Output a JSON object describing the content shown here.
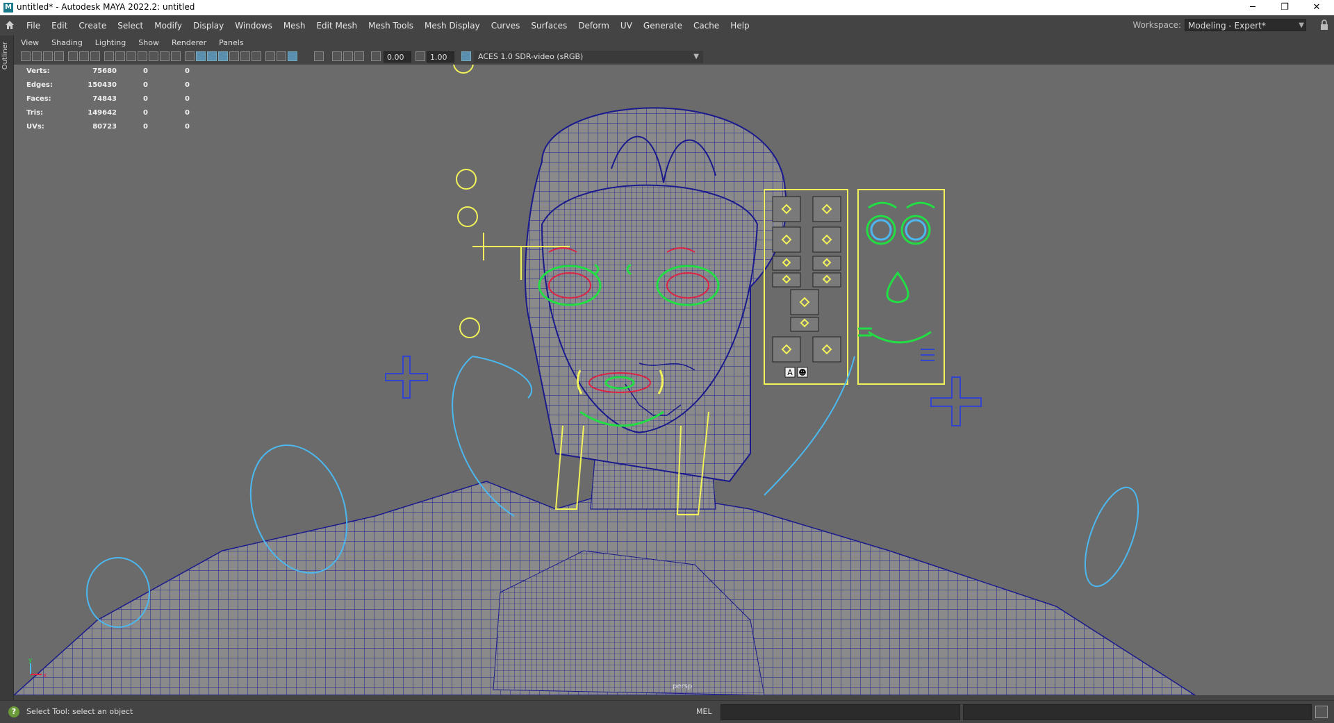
{
  "window": {
    "title": "untitled* - Autodesk MAYA 2022.2: untitled",
    "app_icon": "M",
    "minimize": "─",
    "restore": "❐",
    "close": "✕"
  },
  "menubar": {
    "items": [
      "File",
      "Edit",
      "Create",
      "Select",
      "Modify",
      "Display",
      "Windows",
      "Mesh",
      "Edit Mesh",
      "Mesh Tools",
      "Mesh Display",
      "Curves",
      "Surfaces",
      "Deform",
      "UV",
      "Generate",
      "Cache",
      "Help"
    ],
    "workspace_label": "Workspace:",
    "workspace_value": "Modeling - Expert*"
  },
  "sidebar": {
    "outliner_tab": "Outliner"
  },
  "panel_menu": {
    "items": [
      "View",
      "Shading",
      "Lighting",
      "Show",
      "Renderer",
      "Panels"
    ]
  },
  "toolbar": {
    "exposure": "0.00",
    "gamma": "1.00",
    "color_space": "ACES 1.0 SDR-video (sRGB)"
  },
  "hud": {
    "rows": [
      {
        "label": "Verts:",
        "v1": "75680",
        "v2": "0",
        "v3": "0"
      },
      {
        "label": "Edges:",
        "v1": "150430",
        "v2": "0",
        "v3": "0"
      },
      {
        "label": "Faces:",
        "v1": "74843",
        "v2": "0",
        "v3": "0"
      },
      {
        "label": "Tris:",
        "v1": "149642",
        "v2": "0",
        "v3": "0"
      },
      {
        "label": "UVs:",
        "v1": "80723",
        "v2": "0",
        "v3": "0"
      }
    ]
  },
  "viewport": {
    "camera_label": "persp",
    "axis_x": "x",
    "axis_y": "y",
    "face_panel_button_a": "A",
    "face_panel_button_b": "☻"
  },
  "statusbar": {
    "help_icon": "?",
    "message": "Select Tool: select an object",
    "mel_label": "MEL"
  },
  "colors": {
    "viewport_bg": "#6b6b6b",
    "wireframe": "#1a1a8c",
    "control_yellow": "#f2f25a",
    "control_cyan": "#4cb8f0",
    "control_green": "#22dd44",
    "control_red": "#dd2244"
  }
}
